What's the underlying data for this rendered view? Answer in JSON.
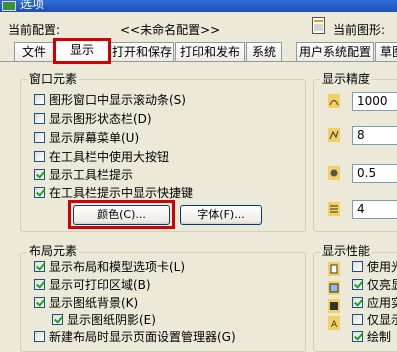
{
  "window": {
    "title": "选项"
  },
  "header": {
    "config_label": "当前配置:",
    "config_value": "<<未命名配置>>",
    "drawing_label": "当前图形:"
  },
  "tabs": [
    {
      "label": "文件"
    },
    {
      "label": "显示",
      "active": true
    },
    {
      "label": "打开和保存"
    },
    {
      "label": "打印和发布"
    },
    {
      "label": "系统"
    },
    {
      "label": "用户系统配置"
    },
    {
      "label": "草图"
    }
  ],
  "window_elements": {
    "title": "窗口元素",
    "items": [
      {
        "label": "图形窗口中显示滚动条(S)",
        "checked": false
      },
      {
        "label": "显示图形状态栏(D)",
        "checked": false
      },
      {
        "label": "显示屏幕菜单(U)",
        "checked": false
      },
      {
        "label": "在工具栏中使用大按钮",
        "checked": false
      },
      {
        "label": "显示工具栏提示",
        "checked": true
      },
      {
        "label": "在工具栏提示中显示快捷键",
        "checked": true
      }
    ],
    "color_button": "颜色(C)...",
    "font_button": "字体(F)..."
  },
  "layout_elements": {
    "title": "布局元素",
    "items": [
      {
        "label": "显示布局和模型选项卡(L)",
        "checked": true
      },
      {
        "label": "显示可打印区域(B)",
        "checked": true
      },
      {
        "label": "显示图纸背景(K)",
        "checked": true
      },
      {
        "label": "显示图纸阴影(E)",
        "checked": true
      },
      {
        "label": "新建布局时显示页面设置管理器(G)",
        "checked": false
      }
    ]
  },
  "display_resolution": {
    "title": "显示精度",
    "values": [
      "1000",
      "8",
      "0.5",
      "4"
    ]
  },
  "display_performance": {
    "title": "显示性能",
    "items": [
      {
        "label": "使用光",
        "checked": false
      },
      {
        "label": "仅亮显",
        "checked": true
      },
      {
        "label": "应用实",
        "checked": true
      },
      {
        "label": "仅显示",
        "checked": false
      },
      {
        "label": "绘制",
        "checked": true
      }
    ]
  },
  "colors": {
    "accent_red": "#d10000",
    "title_bar": "#2f6fdc",
    "check_green": "#21a121"
  }
}
